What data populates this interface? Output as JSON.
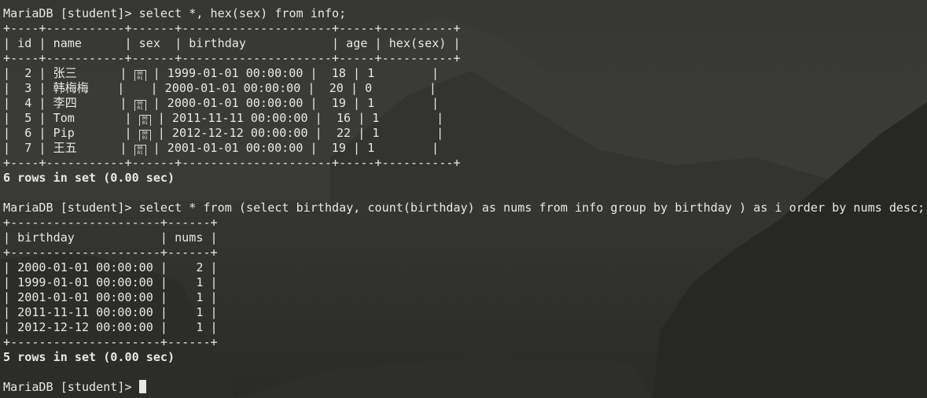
{
  "terminal": {
    "prompt": "MariaDB [student]> ",
    "query1": "select *, hex(sex) from info;",
    "table1": {
      "border": "+----+-----------+------+---------------------+-----+----------+",
      "header": "| id | name      | sex  | birthday            | age | hex(sex) |",
      "rows": [
        {
          "pre": "|  2 | 张三      | ",
          "sex_glyph": "0001",
          "post": " | 1999-01-01 00:00:00 |  18 | 1        |"
        },
        {
          "pre": "|  3 | 韩梅梅    | ",
          "sex_glyph": "",
          "post": " | 2000-01-01 00:00:00 |  20 | 0        |"
        },
        {
          "pre": "|  4 | 李四      | ",
          "sex_glyph": "0001",
          "post": " | 2000-01-01 00:00:00 |  19 | 1        |"
        },
        {
          "pre": "|  5 | Tom       | ",
          "sex_glyph": "0001",
          "post": " | 2011-11-11 00:00:00 |  16 | 1        |"
        },
        {
          "pre": "|  6 | Pip       | ",
          "sex_glyph": "0001",
          "post": " | 2012-12-12 00:00:00 |  22 | 1        |"
        },
        {
          "pre": "|  7 | 王五      | ",
          "sex_glyph": "0001",
          "post": " | 2001-01-01 00:00:00 |  19 | 1        |"
        }
      ]
    },
    "result1": "6 rows in set (0.00 sec)",
    "query2": "select * from (select birthday, count(birthday) as nums from info group by birthday ) as i order by nums desc;",
    "table2": {
      "border": "+---------------------+------+",
      "header": "| birthday            | nums |",
      "rows": [
        "| 2000-01-01 00:00:00 |    2 |",
        "| 1999-01-01 00:00:00 |    1 |",
        "| 2001-01-01 00:00:00 |    1 |",
        "| 2011-11-11 00:00:00 |    1 |",
        "| 2012-12-12 00:00:00 |    1 |"
      ]
    },
    "result2": "5 rows in set (0.00 sec)",
    "input_value": ""
  },
  "colors": {
    "text": "#e8e8e6",
    "background": "#2b2b29"
  }
}
